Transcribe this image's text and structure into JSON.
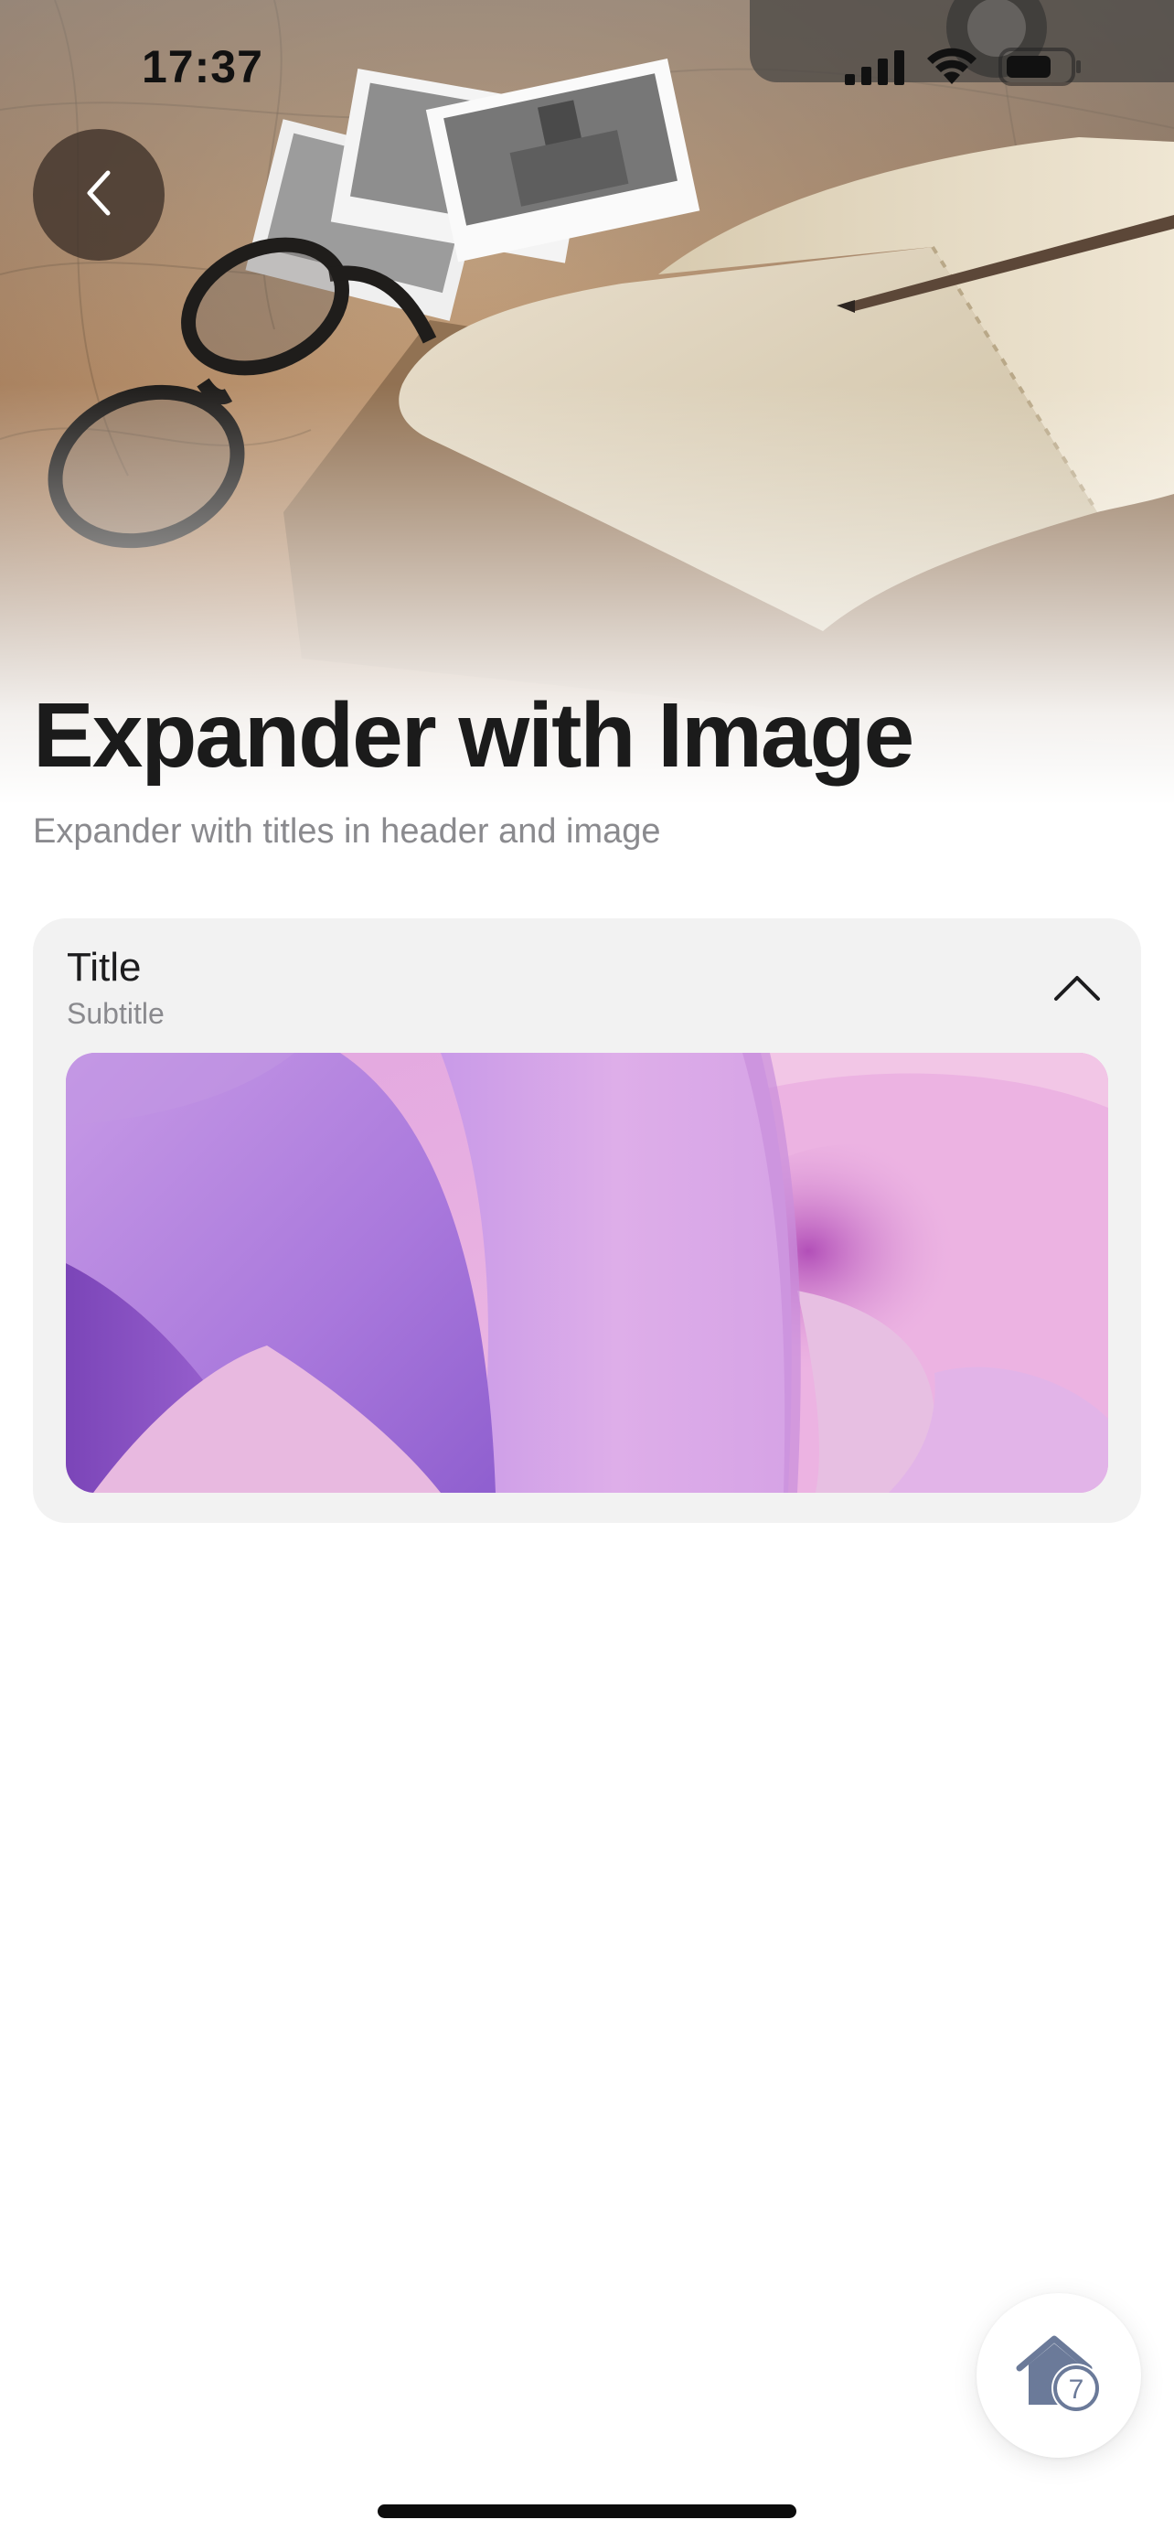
{
  "status_bar": {
    "time": "17:37",
    "icons": [
      "cellular-signal-icon",
      "wifi-icon",
      "battery-icon"
    ]
  },
  "navigation": {
    "back_icon": "chevron-left-icon"
  },
  "header": {
    "title": "Expander with Image",
    "subtitle": "Expander with titles in header and image"
  },
  "expander": {
    "title": "Title",
    "subtitle": "Subtitle",
    "state": "expanded",
    "toggle_icon": "chevron-up-icon"
  },
  "home_button": {
    "icon": "house-icon",
    "badge": "7"
  },
  "colors": {
    "card_background": "#f2f2f2",
    "title_text": "#1b1b1b",
    "secondary_text": "#8a8a8e",
    "home_icon": "#6b7a99"
  }
}
